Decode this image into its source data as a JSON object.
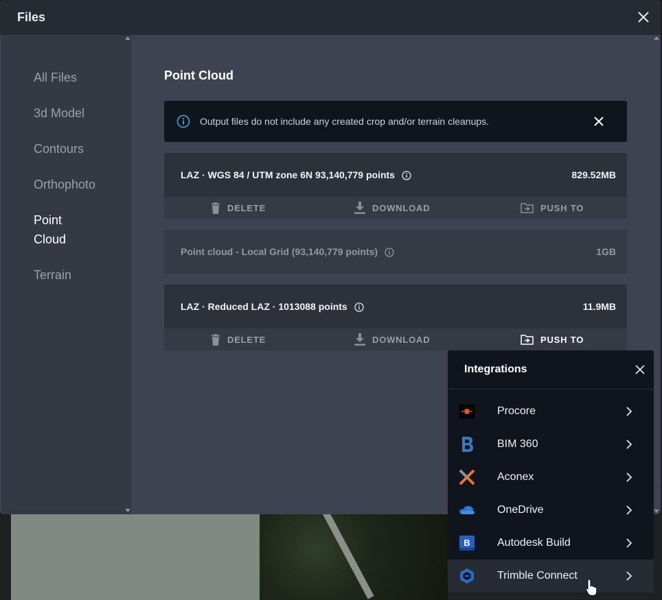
{
  "window": {
    "title": "Files"
  },
  "sidebar": {
    "items": [
      {
        "label": "All Files",
        "active": false
      },
      {
        "label": "3d Model",
        "active": false
      },
      {
        "label": "Contours",
        "active": false
      },
      {
        "label": "Orthophoto",
        "active": false
      },
      {
        "label": "Point Cloud",
        "active": true
      },
      {
        "label": "Terrain",
        "active": false
      }
    ]
  },
  "main": {
    "section_title": "Point Cloud",
    "banner": {
      "text": "Output files do not include any created crop and/or terrain cleanups.",
      "icon": "info-icon"
    },
    "files": [
      {
        "name": "LAZ · WGS 84 / UTM zone 6N 93,140,779 points",
        "size": "829.52MB",
        "has_actions": true
      },
      {
        "name": "Point cloud - Local Grid (93,140,779 points)",
        "size": "1GB",
        "has_actions": false
      },
      {
        "name": "LAZ · Reduced LAZ · 1013088 points",
        "size": "11.9MB",
        "has_actions": true
      }
    ],
    "actions": {
      "delete": "DELETE",
      "download": "DOWNLOAD",
      "push_to": "PUSH TO"
    }
  },
  "integrations": {
    "title": "Integrations",
    "items": [
      {
        "label": "Procore",
        "icon": "procore-logo-icon",
        "color": "#f04e23"
      },
      {
        "label": "BIM 360",
        "icon": "bim360-logo-icon",
        "color": "#3b78c3"
      },
      {
        "label": "Aconex",
        "icon": "aconex-logo-icon",
        "color": "#e8762d"
      },
      {
        "label": "OneDrive",
        "icon": "onedrive-logo-icon",
        "color": "#2f7bd8"
      },
      {
        "label": "Autodesk Build",
        "icon": "autodesk-build-logo-icon",
        "color": "#2a5fc2"
      },
      {
        "label": "Trimble Connect",
        "icon": "trimble-connect-logo-icon",
        "color": "#2a6bc8"
      }
    ]
  },
  "colors": {
    "window_bg": "#3d4350",
    "sidebar_bg": "#343944",
    "popup_bg": "#10151d",
    "info_blue": "#4aa3ea"
  }
}
